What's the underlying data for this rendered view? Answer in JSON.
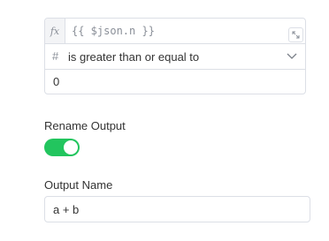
{
  "condition": {
    "expression_badge": "fx",
    "expression": "{{ $json.n }}",
    "type_icon": "hash-icon",
    "operator": "is greater than or equal to",
    "value": "0"
  },
  "rename_output": {
    "label": "Rename Output",
    "enabled": true,
    "toggle_color": "#22c55e"
  },
  "output_name": {
    "label": "Output Name",
    "value": "a + b"
  }
}
